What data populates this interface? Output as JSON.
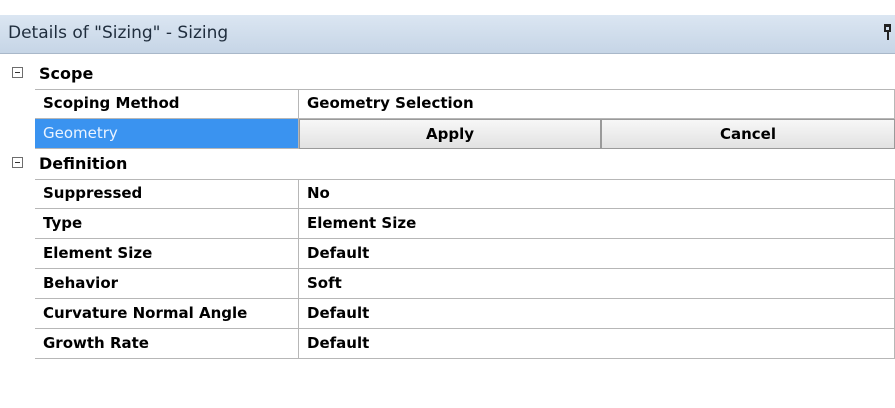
{
  "panel": {
    "title": "Details of \"Sizing\" - Sizing"
  },
  "groups": {
    "scope": {
      "label": "Scope",
      "rows": {
        "scoping_method": {
          "name": "Scoping Method",
          "value": "Geometry Selection"
        },
        "geometry": {
          "name": "Geometry",
          "apply_label": "Apply",
          "cancel_label": "Cancel"
        }
      }
    },
    "definition": {
      "label": "Definition",
      "rows": [
        {
          "name": "Suppressed",
          "value": "No"
        },
        {
          "name": "Type",
          "value": "Element Size"
        },
        {
          "name": "Element Size",
          "value": "Default"
        },
        {
          "name": "Behavior",
          "value": "Soft"
        },
        {
          "name": "Curvature Normal Angle",
          "value": "Default"
        },
        {
          "name": "Growth Rate",
          "value": "Default"
        }
      ]
    }
  },
  "colors": {
    "selection": "#3a93f0",
    "title_bar": "#cfdcea"
  },
  "icons": {
    "collapse": "collapse-minus-icon",
    "pin": "pin-icon"
  }
}
